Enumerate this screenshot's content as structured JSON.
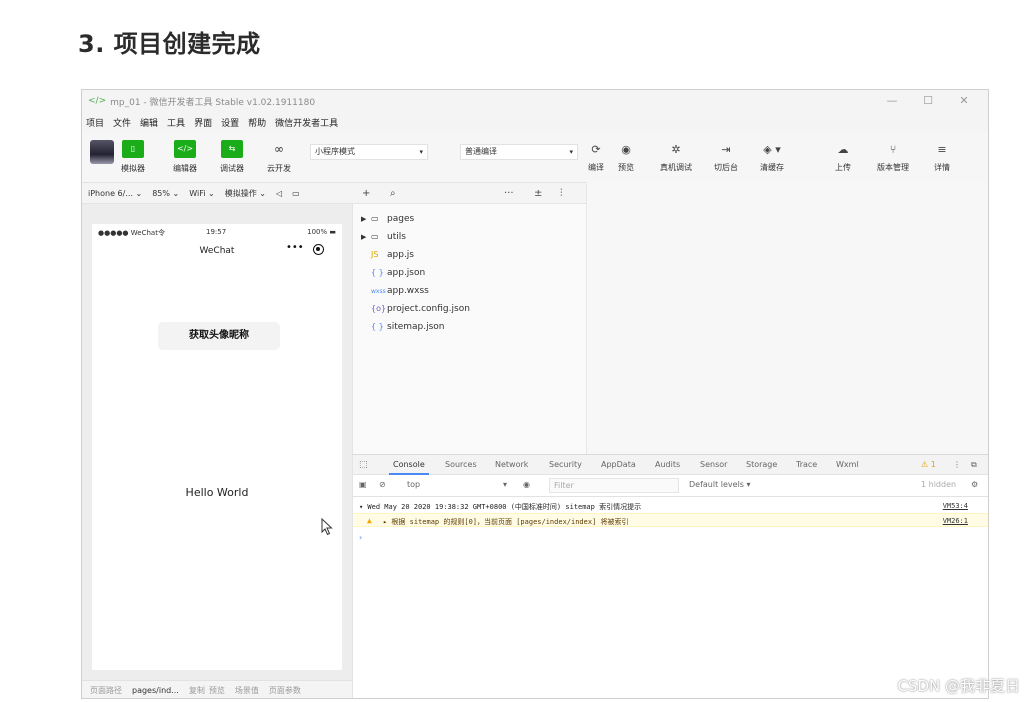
{
  "heading": "3. 项目创建完成",
  "window": {
    "title": "mp_01 - 微信开发者工具 Stable v1.02.1911180",
    "controls": [
      "—",
      "☐",
      "✕"
    ]
  },
  "menu": [
    "项目",
    "文件",
    "编辑",
    "工具",
    "界面",
    "设置",
    "帮助",
    "微信开发者工具"
  ],
  "toolbar": {
    "simulator": {
      "icon": "</>",
      "label": "模拟器"
    },
    "editor": {
      "icon": "</>",
      "label": "编辑器"
    },
    "debugger": {
      "icon": "⇆",
      "label": "调试器"
    },
    "cloud": {
      "label": "云开发"
    },
    "mode_select": "小程序模式",
    "compile_select": "普通编译",
    "compile": "编译",
    "preview": "预览",
    "remote_debug": "真机调试",
    "switch_bg": "切后台",
    "clear_cache": "清缓存",
    "upload": "上传",
    "version": "版本管理",
    "details": "详情"
  },
  "sim_bar": {
    "device": "iPhone 6/... ⌄",
    "zoom": "85% ⌄",
    "network": "WiFi ⌄",
    "operations": "模拟操作 ⌄"
  },
  "phone": {
    "status_left": "●●●●● WeChat令",
    "status_time": "19:57",
    "status_battery": "100% ▬",
    "nav_title": "WeChat",
    "capsule_dots": "•••",
    "button_label": "获取头像昵称",
    "hello": "Hello World"
  },
  "bottom_bar": {
    "path_label": "页面路径",
    "path": "pages/ind...",
    "copy": "复制",
    "preview": "预览",
    "scene": "场景值",
    "params": "页面参数"
  },
  "explorer_bar": {
    "more": "···",
    "sort": "±",
    "collapse": "⫶"
  },
  "files": [
    {
      "name": "pages",
      "type": "folder",
      "icon": "▭"
    },
    {
      "name": "utils",
      "type": "folder",
      "icon": "▭"
    },
    {
      "name": "app.js",
      "type": "js",
      "icon": "JS"
    },
    {
      "name": "app.json",
      "type": "json",
      "icon": "{ }"
    },
    {
      "name": "app.wxss",
      "type": "wxss",
      "icon": "wxss"
    },
    {
      "name": "project.config.json",
      "type": "json",
      "icon": "{o}"
    },
    {
      "name": "sitemap.json",
      "type": "json",
      "icon": "{ }"
    }
  ],
  "devtools": {
    "tabs": [
      "Console",
      "Sources",
      "Network",
      "Security",
      "AppData",
      "Audits",
      "Sensor",
      "Storage",
      "Trace",
      "Wxml"
    ],
    "warning_count": "⚠ 1",
    "context": "top",
    "filter_placeholder": "Filter",
    "levels": "Default levels ▾",
    "hidden": "1 hidden",
    "logs": [
      {
        "type": "info",
        "text": "▾ Wed May 20 2020 19:38:32 GMT+0800 (中国标准时间) sitemap 索引情况提示",
        "source": "VM53:4"
      },
      {
        "type": "warn",
        "text": "▸ 根据 sitemap 的规则[0]，当前页面 [pages/index/index] 将被索引",
        "source": "VM26:1"
      }
    ],
    "prompt": "›"
  },
  "watermark": "CSDN @我非夏日"
}
